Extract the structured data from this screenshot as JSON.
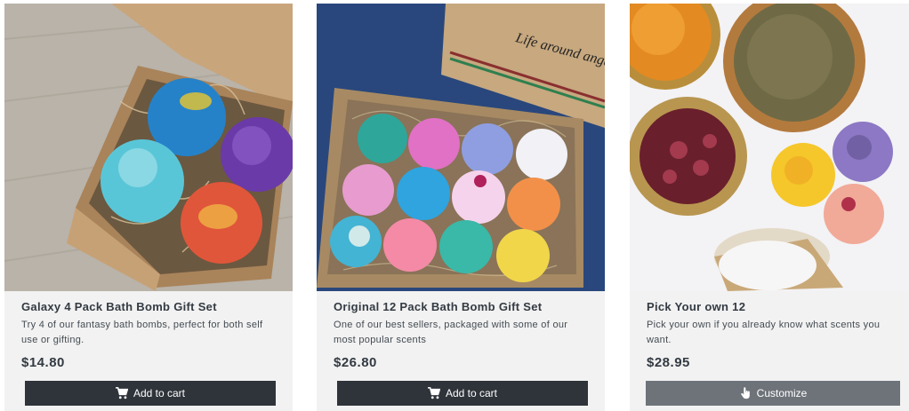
{
  "products": [
    {
      "title": "Galaxy 4 Pack Bath Bomb Gift Set",
      "description": "Try 4 of our fantasy bath bombs, perfect for both self use or gifting.",
      "price": "$14.80",
      "button_label": "Add to cart",
      "button_icon": "shopping-cart-icon"
    },
    {
      "title": "Original 12 Pack Bath Bomb Gift Set",
      "description": "One of our best sellers, packaged with some of our most popular scents",
      "price": "$26.80",
      "button_label": "Add to cart",
      "button_icon": "shopping-cart-icon"
    },
    {
      "title": "Pick Your own 12",
      "description": "Pick your own if you already know what scents you want.",
      "price": "$28.95",
      "button_label": "Customize",
      "button_icon": "hand-pointer-icon"
    }
  ],
  "box_logo_text": "Life around angels",
  "colors": {
    "card_bg": "#f2f2f2",
    "button_dark": "#2f343b",
    "button_gray": "#6e737a",
    "text_dark": "#333a42"
  }
}
